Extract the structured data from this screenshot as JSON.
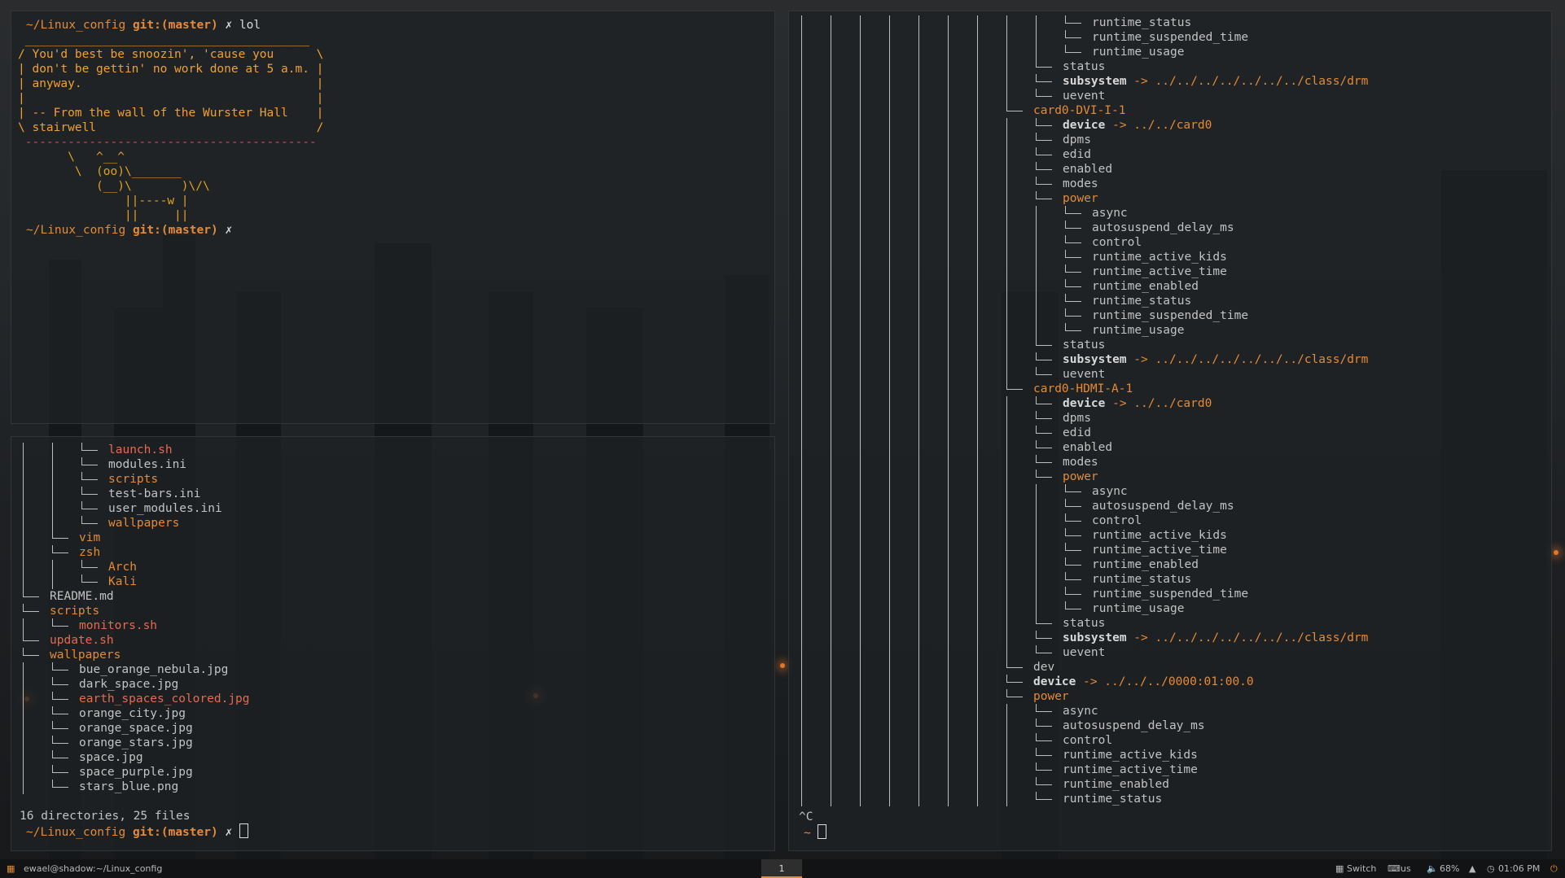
{
  "colors": {
    "accent": "#e58a35",
    "dir": "#e58a35",
    "exec": "#e46a50",
    "file": "#c2c2c2"
  },
  "t1": {
    "prompt1_path": "~/Linux_config",
    "prompt1_git": "git:(master)",
    "prompt1_cmd": "✗ lol",
    "cow_top": " ________________________________________",
    "cow_lines": [
      "/ You'd best be snoozin', 'cause you      \\",
      "| don't be gettin' no work done at 5 a.m. |",
      "| anyway.                                 |",
      "|                                         |",
      "| -- From the wall of the Wurster Hall    |",
      "\\ stairwell                               /"
    ],
    "cow_bottom": " -----------------------------------------",
    "cow_art": [
      "       \\   ^__^",
      "        \\  (oo)\\_______",
      "           (__)\\       )\\/\\",
      "               ||----w |",
      "               ||     ||"
    ],
    "prompt2_path": "~/Linux_config",
    "prompt2_git": "git:(master)",
    "prompt2_cmd": "✗"
  },
  "t2": {
    "items": [
      {
        "d": 3,
        "t": "launch.sh",
        "c": "r"
      },
      {
        "d": 3,
        "t": "modules.ini",
        "c": "f"
      },
      {
        "d": 3,
        "t": "scripts",
        "c": "o"
      },
      {
        "d": 3,
        "t": "test-bars.ini",
        "c": "f"
      },
      {
        "d": 3,
        "t": "user_modules.ini",
        "c": "f"
      },
      {
        "d": 3,
        "t": "wallpapers",
        "c": "o"
      },
      {
        "d": 2,
        "t": "vim",
        "c": "o"
      },
      {
        "d": 2,
        "t": "zsh",
        "c": "o"
      },
      {
        "d": 3,
        "t": "Arch",
        "c": "o"
      },
      {
        "d": 3,
        "t": "Kali",
        "c": "o"
      },
      {
        "d": 1,
        "t": "README.md",
        "c": "f"
      },
      {
        "d": 1,
        "t": "scripts",
        "c": "o"
      },
      {
        "d": 2,
        "t": "monitors.sh",
        "c": "r"
      },
      {
        "d": 1,
        "t": "update.sh",
        "c": "r"
      },
      {
        "d": 1,
        "t": "wallpapers",
        "c": "o"
      },
      {
        "d": 2,
        "t": "bue_orange_nebula.jpg",
        "c": "f"
      },
      {
        "d": 2,
        "t": "dark_space.jpg",
        "c": "f"
      },
      {
        "d": 2,
        "t": "earth_spaces_colored.jpg",
        "c": "r"
      },
      {
        "d": 2,
        "t": "orange_city.jpg",
        "c": "f"
      },
      {
        "d": 2,
        "t": "orange_space.jpg",
        "c": "f"
      },
      {
        "d": 2,
        "t": "orange_stars.jpg",
        "c": "f"
      },
      {
        "d": 2,
        "t": "space.jpg",
        "c": "f"
      },
      {
        "d": 2,
        "t": "space_purple.jpg",
        "c": "f"
      },
      {
        "d": 2,
        "t": "stars_blue.png",
        "c": "f"
      }
    ],
    "summary": "16 directories, 25 files",
    "prompt_path": "~/Linux_config",
    "prompt_git": "git:(master)",
    "prompt_cmd": "✗"
  },
  "t3": {
    "items": [
      {
        "d": 10,
        "t": "runtime_status",
        "c": "f"
      },
      {
        "d": 10,
        "t": "runtime_suspended_time",
        "c": "f"
      },
      {
        "d": 10,
        "t": "runtime_usage",
        "c": "f"
      },
      {
        "d": 9,
        "t": "status",
        "c": "f"
      },
      {
        "d": 9,
        "t": "subsystem",
        "c": "w",
        "l": "-> ../../../../../../../class/drm"
      },
      {
        "d": 9,
        "t": "uevent",
        "c": "f"
      },
      {
        "d": 8,
        "t": "card0-DVI-I-1",
        "c": "o"
      },
      {
        "d": 9,
        "t": "device",
        "c": "w",
        "l": "-> ../../card0"
      },
      {
        "d": 9,
        "t": "dpms",
        "c": "f"
      },
      {
        "d": 9,
        "t": "edid",
        "c": "f"
      },
      {
        "d": 9,
        "t": "enabled",
        "c": "f"
      },
      {
        "d": 9,
        "t": "modes",
        "c": "f"
      },
      {
        "d": 9,
        "t": "power",
        "c": "o"
      },
      {
        "d": 10,
        "t": "async",
        "c": "f"
      },
      {
        "d": 10,
        "t": "autosuspend_delay_ms",
        "c": "f"
      },
      {
        "d": 10,
        "t": "control",
        "c": "f"
      },
      {
        "d": 10,
        "t": "runtime_active_kids",
        "c": "f"
      },
      {
        "d": 10,
        "t": "runtime_active_time",
        "c": "f"
      },
      {
        "d": 10,
        "t": "runtime_enabled",
        "c": "f"
      },
      {
        "d": 10,
        "t": "runtime_status",
        "c": "f"
      },
      {
        "d": 10,
        "t": "runtime_suspended_time",
        "c": "f"
      },
      {
        "d": 10,
        "t": "runtime_usage",
        "c": "f"
      },
      {
        "d": 9,
        "t": "status",
        "c": "f"
      },
      {
        "d": 9,
        "t": "subsystem",
        "c": "w",
        "l": "-> ../../../../../../../class/drm"
      },
      {
        "d": 9,
        "t": "uevent",
        "c": "f"
      },
      {
        "d": 8,
        "t": "card0-HDMI-A-1",
        "c": "o"
      },
      {
        "d": 9,
        "t": "device",
        "c": "w",
        "l": "-> ../../card0"
      },
      {
        "d": 9,
        "t": "dpms",
        "c": "f"
      },
      {
        "d": 9,
        "t": "edid",
        "c": "f"
      },
      {
        "d": 9,
        "t": "enabled",
        "c": "f"
      },
      {
        "d": 9,
        "t": "modes",
        "c": "f"
      },
      {
        "d": 9,
        "t": "power",
        "c": "o"
      },
      {
        "d": 10,
        "t": "async",
        "c": "f"
      },
      {
        "d": 10,
        "t": "autosuspend_delay_ms",
        "c": "f"
      },
      {
        "d": 10,
        "t": "control",
        "c": "f"
      },
      {
        "d": 10,
        "t": "runtime_active_kids",
        "c": "f"
      },
      {
        "d": 10,
        "t": "runtime_active_time",
        "c": "f"
      },
      {
        "d": 10,
        "t": "runtime_enabled",
        "c": "f"
      },
      {
        "d": 10,
        "t": "runtime_status",
        "c": "f"
      },
      {
        "d": 10,
        "t": "runtime_suspended_time",
        "c": "f"
      },
      {
        "d": 10,
        "t": "runtime_usage",
        "c": "f"
      },
      {
        "d": 9,
        "t": "status",
        "c": "f"
      },
      {
        "d": 9,
        "t": "subsystem",
        "c": "w",
        "l": "-> ../../../../../../../class/drm"
      },
      {
        "d": 9,
        "t": "uevent",
        "c": "f"
      },
      {
        "d": 8,
        "t": "dev",
        "c": "f"
      },
      {
        "d": 8,
        "t": "device",
        "c": "w",
        "l": "-> ../../../0000:01:00.0"
      },
      {
        "d": 8,
        "t": "power",
        "c": "o"
      },
      {
        "d": 9,
        "t": "async",
        "c": "f"
      },
      {
        "d": 9,
        "t": "autosuspend_delay_ms",
        "c": "f"
      },
      {
        "d": 9,
        "t": "control",
        "c": "f"
      },
      {
        "d": 9,
        "t": "runtime_active_kids",
        "c": "f"
      },
      {
        "d": 9,
        "t": "runtime_active_time",
        "c": "f"
      },
      {
        "d": 9,
        "t": "runtime_enabled",
        "c": "f"
      },
      {
        "d": 9,
        "t": "runtime_status",
        "c": "f"
      }
    ],
    "interrupt": "^C",
    "prompt": "~"
  },
  "statusbar": {
    "menu_icon": "grid-icon",
    "user_host": "ewael@shadow:~/Linux_config",
    "workspace": "1",
    "switch_label": "Switch",
    "keyboard_label": "us",
    "volume": "68%",
    "time": "01:06 PM",
    "power_icon": "power-icon"
  }
}
